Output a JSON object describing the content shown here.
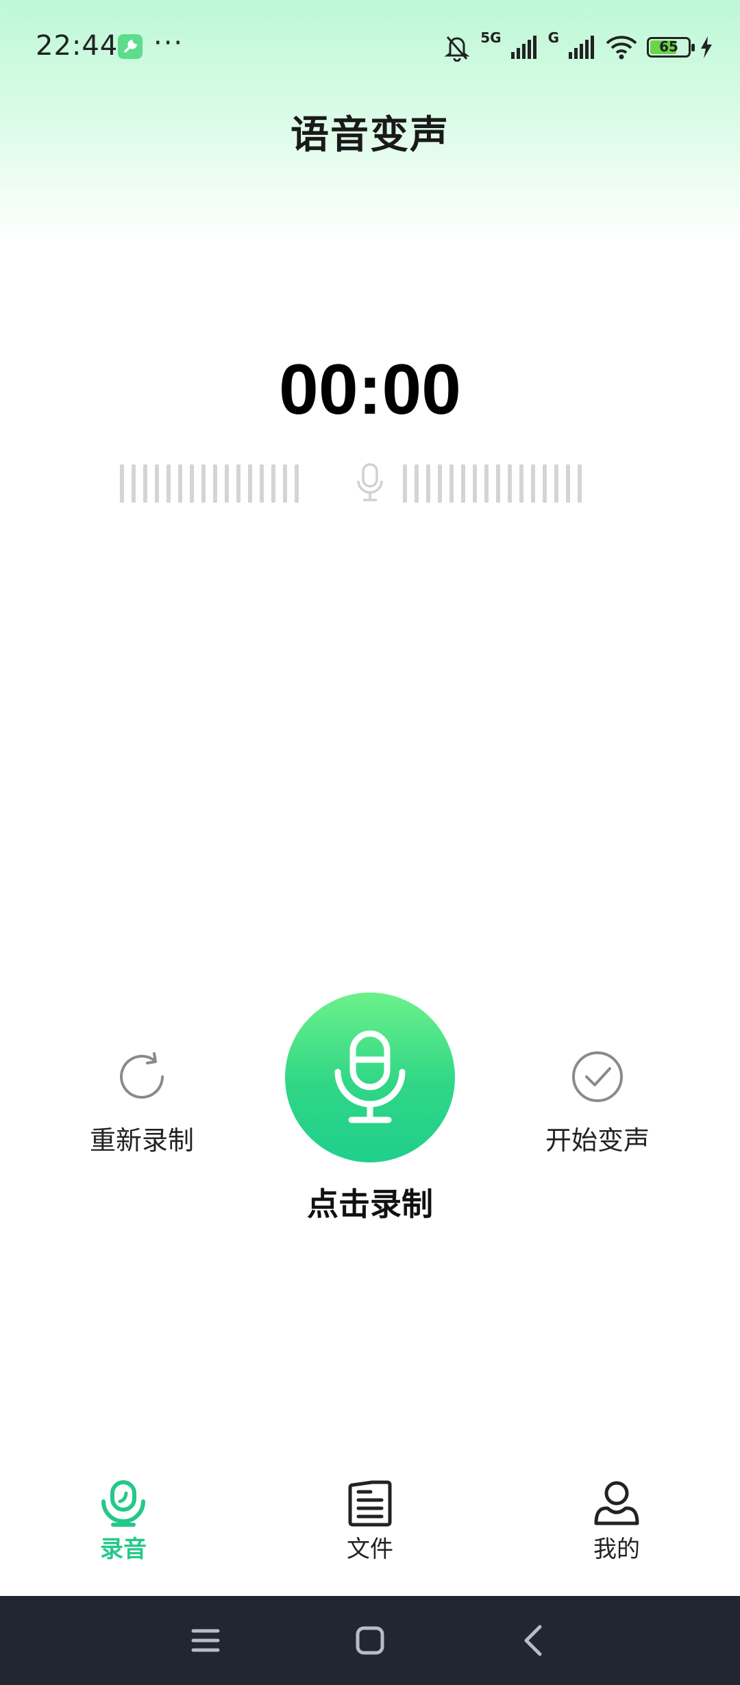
{
  "status_bar": {
    "time": "22:44",
    "more": "···",
    "signal_1_label": "5G",
    "signal_2_label": "G",
    "battery_level": "65",
    "icons": [
      "app-tool-icon",
      "mute-bell-icon",
      "signal-icon",
      "wifi-icon",
      "battery-icon",
      "charging-icon"
    ]
  },
  "header": {
    "title": "语音变声"
  },
  "recorder": {
    "timer": "00:00",
    "rerecord_label": "重新录制",
    "start_voice_change_label": "开始变声",
    "record_label": "点击录制"
  },
  "bottom_nav": {
    "items": [
      {
        "label": "录音",
        "icon": "record-mic-icon",
        "active": true
      },
      {
        "label": "文件",
        "icon": "file-icon",
        "active": false
      },
      {
        "label": "我的",
        "icon": "profile-icon",
        "active": false
      }
    ]
  },
  "system_nav": {
    "icons": [
      "menu-icon",
      "home-icon",
      "back-icon"
    ]
  },
  "colors": {
    "accent": "#23c98a",
    "header_gradient_top": "#bef8d6",
    "record_button_top": "#6cf18b",
    "record_button_bottom": "#1fcf8b",
    "system_nav_bg": "#222631",
    "waveform_bar": "#d4d4d4"
  }
}
